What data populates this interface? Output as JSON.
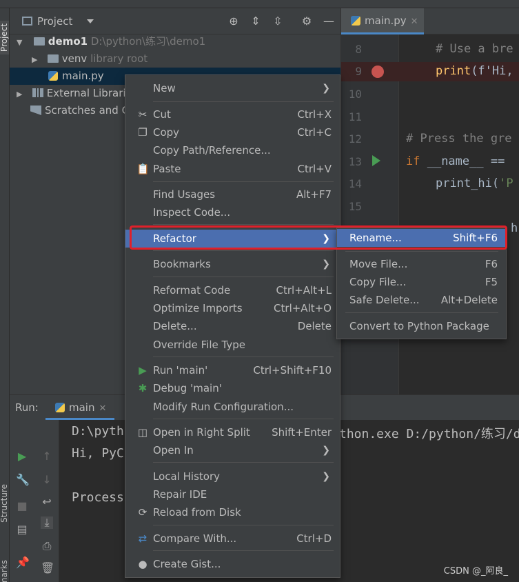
{
  "colors": {
    "accent": "#4b6eaf",
    "highlight_box": "#e0202a",
    "breakpoint": "#c75450",
    "run": "#499c54"
  },
  "sidebar": {
    "project_label": "Project",
    "structure_label": "Structure",
    "bookmarks_label": "kmarks"
  },
  "project": {
    "title": "Project",
    "header_icons": [
      "locate-icon",
      "expand-all-icon",
      "collapse-all-icon",
      "gear-icon",
      "minimize-icon"
    ],
    "tree": [
      {
        "name": "demo1",
        "path": "D:\\python\\练习\\demo1"
      },
      {
        "name": "venv",
        "note": "library root"
      },
      {
        "name": "main.py"
      },
      {
        "name": "External Librarie"
      },
      {
        "name": "Scratches and C"
      }
    ]
  },
  "editor": {
    "tab_label": "main.py",
    "line_numbers": [
      "8",
      "9",
      "10",
      "11",
      "12",
      "13",
      "14",
      "15"
    ],
    "lines": {
      "l8": "# Use a bre",
      "l9_fn": "print",
      "l9_rest": "(f'Hi,",
      "l12": "# Press the gre",
      "l13_kw": "if",
      "l13_rest": " __name__ ==",
      "l14_a": "print_hi(",
      "l14_b": "'P",
      "l16": "h"
    }
  },
  "run": {
    "label": "Run:",
    "tab_label": "main",
    "console": [
      "D:\\pyth",
      "Hi, PyC",
      "",
      "Process"
    ],
    "console_right": "thon.exe D:/python/练习/d"
  },
  "menu": {
    "items": [
      {
        "label": "New",
        "submenu": true
      },
      {
        "label": "Cut",
        "shortcut": "Ctrl+X",
        "icon": "scissors-icon"
      },
      {
        "label": "Copy",
        "shortcut": "Ctrl+C",
        "icon": "copy-icon"
      },
      {
        "label": "Copy Path/Reference..."
      },
      {
        "label": "Paste",
        "shortcut": "Ctrl+V",
        "icon": "paste-icon"
      },
      {
        "label": "Find Usages",
        "shortcut": "Alt+F7"
      },
      {
        "label": "Inspect Code..."
      },
      {
        "label": "Refactor",
        "submenu": true
      },
      {
        "label": "Bookmarks",
        "submenu": true
      },
      {
        "label": "Reformat Code",
        "shortcut": "Ctrl+Alt+L"
      },
      {
        "label": "Optimize Imports",
        "shortcut": "Ctrl+Alt+O"
      },
      {
        "label": "Delete...",
        "shortcut": "Delete"
      },
      {
        "label": "Override File Type"
      },
      {
        "label": "Run 'main'",
        "shortcut": "Ctrl+Shift+F10",
        "icon": "run-icon"
      },
      {
        "label": "Debug 'main'",
        "icon": "debug-icon"
      },
      {
        "label": "Modify Run Configuration..."
      },
      {
        "label": "Open in Right Split",
        "shortcut": "Shift+Enter",
        "icon": "split-icon"
      },
      {
        "label": "Open In",
        "submenu": true
      },
      {
        "label": "Local History",
        "submenu": true
      },
      {
        "label": "Repair IDE"
      },
      {
        "label": "Reload from Disk",
        "icon": "reload-icon"
      },
      {
        "label": "Compare With...",
        "shortcut": "Ctrl+D",
        "icon": "compare-icon"
      },
      {
        "label": "Create Gist...",
        "icon": "github-icon"
      }
    ]
  },
  "submenu": {
    "items": [
      {
        "label": "Rename...",
        "shortcut": "Shift+F6"
      },
      {
        "label": "Move File...",
        "shortcut": "F6"
      },
      {
        "label": "Copy File...",
        "shortcut": "F5"
      },
      {
        "label": "Safe Delete...",
        "shortcut": "Alt+Delete"
      },
      {
        "label": "Convert to Python Package"
      }
    ]
  },
  "watermark": "CSDN @_阿良_"
}
